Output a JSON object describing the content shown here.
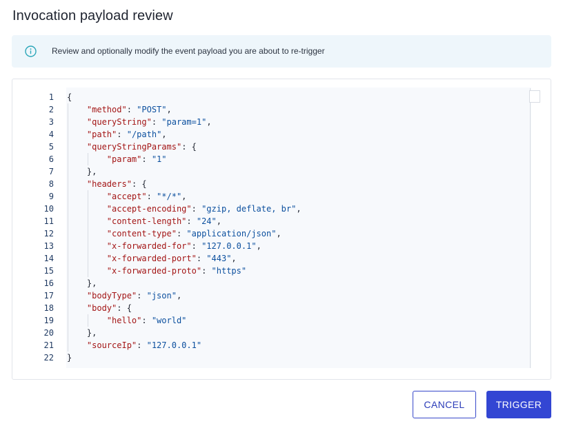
{
  "dialog": {
    "title": "Invocation payload review",
    "info_message": "Review and optionally modify the event payload you are about to re-trigger",
    "info_icon": "info-circle-icon"
  },
  "editor": {
    "line_numbers": [
      "1",
      "2",
      "3",
      "4",
      "5",
      "6",
      "7",
      "8",
      "9",
      "10",
      "11",
      "12",
      "13",
      "14",
      "15",
      "16",
      "17",
      "18",
      "19",
      "20",
      "21",
      "22"
    ],
    "lines": [
      {
        "indent": 0,
        "tokens": [
          {
            "t": "p",
            "v": "{"
          }
        ]
      },
      {
        "indent": 1,
        "tokens": [
          {
            "t": "k",
            "v": "\"method\""
          },
          {
            "t": "p",
            "v": ": "
          },
          {
            "t": "s",
            "v": "\"POST\""
          },
          {
            "t": "p",
            "v": ","
          }
        ]
      },
      {
        "indent": 1,
        "tokens": [
          {
            "t": "k",
            "v": "\"queryString\""
          },
          {
            "t": "p",
            "v": ": "
          },
          {
            "t": "s",
            "v": "\"param=1\""
          },
          {
            "t": "p",
            "v": ","
          }
        ]
      },
      {
        "indent": 1,
        "tokens": [
          {
            "t": "k",
            "v": "\"path\""
          },
          {
            "t": "p",
            "v": ": "
          },
          {
            "t": "s",
            "v": "\"/path\""
          },
          {
            "t": "p",
            "v": ","
          }
        ]
      },
      {
        "indent": 1,
        "tokens": [
          {
            "t": "k",
            "v": "\"queryStringParams\""
          },
          {
            "t": "p",
            "v": ": {"
          }
        ]
      },
      {
        "indent": 2,
        "tokens": [
          {
            "t": "k",
            "v": "\"param\""
          },
          {
            "t": "p",
            "v": ": "
          },
          {
            "t": "s",
            "v": "\"1\""
          }
        ]
      },
      {
        "indent": 1,
        "tokens": [
          {
            "t": "p",
            "v": "},"
          }
        ]
      },
      {
        "indent": 1,
        "tokens": [
          {
            "t": "k",
            "v": "\"headers\""
          },
          {
            "t": "p",
            "v": ": {"
          }
        ]
      },
      {
        "indent": 2,
        "tokens": [
          {
            "t": "k",
            "v": "\"accept\""
          },
          {
            "t": "p",
            "v": ": "
          },
          {
            "t": "s",
            "v": "\"*/*\""
          },
          {
            "t": "p",
            "v": ","
          }
        ]
      },
      {
        "indent": 2,
        "tokens": [
          {
            "t": "k",
            "v": "\"accept-encoding\""
          },
          {
            "t": "p",
            "v": ": "
          },
          {
            "t": "s",
            "v": "\"gzip, deflate, br\""
          },
          {
            "t": "p",
            "v": ","
          }
        ]
      },
      {
        "indent": 2,
        "tokens": [
          {
            "t": "k",
            "v": "\"content-length\""
          },
          {
            "t": "p",
            "v": ": "
          },
          {
            "t": "s",
            "v": "\"24\""
          },
          {
            "t": "p",
            "v": ","
          }
        ]
      },
      {
        "indent": 2,
        "tokens": [
          {
            "t": "k",
            "v": "\"content-type\""
          },
          {
            "t": "p",
            "v": ": "
          },
          {
            "t": "s",
            "v": "\"application/json\""
          },
          {
            "t": "p",
            "v": ","
          }
        ]
      },
      {
        "indent": 2,
        "tokens": [
          {
            "t": "k",
            "v": "\"x-forwarded-for\""
          },
          {
            "t": "p",
            "v": ": "
          },
          {
            "t": "s",
            "v": "\"127.0.0.1\""
          },
          {
            "t": "p",
            "v": ","
          }
        ]
      },
      {
        "indent": 2,
        "tokens": [
          {
            "t": "k",
            "v": "\"x-forwarded-port\""
          },
          {
            "t": "p",
            "v": ": "
          },
          {
            "t": "s",
            "v": "\"443\""
          },
          {
            "t": "p",
            "v": ","
          }
        ]
      },
      {
        "indent": 2,
        "tokens": [
          {
            "t": "k",
            "v": "\"x-forwarded-proto\""
          },
          {
            "t": "p",
            "v": ": "
          },
          {
            "t": "s",
            "v": "\"https\""
          }
        ]
      },
      {
        "indent": 1,
        "tokens": [
          {
            "t": "p",
            "v": "},"
          }
        ]
      },
      {
        "indent": 1,
        "tokens": [
          {
            "t": "k",
            "v": "\"bodyType\""
          },
          {
            "t": "p",
            "v": ": "
          },
          {
            "t": "s",
            "v": "\"json\""
          },
          {
            "t": "p",
            "v": ","
          }
        ]
      },
      {
        "indent": 1,
        "tokens": [
          {
            "t": "k",
            "v": "\"body\""
          },
          {
            "t": "p",
            "v": ": {"
          }
        ]
      },
      {
        "indent": 2,
        "tokens": [
          {
            "t": "k",
            "v": "\"hello\""
          },
          {
            "t": "p",
            "v": ": "
          },
          {
            "t": "s",
            "v": "\"world\""
          }
        ]
      },
      {
        "indent": 1,
        "tokens": [
          {
            "t": "p",
            "v": "},"
          }
        ]
      },
      {
        "indent": 1,
        "tokens": [
          {
            "t": "k",
            "v": "\"sourceIp\""
          },
          {
            "t": "p",
            "v": ": "
          },
          {
            "t": "s",
            "v": "\"127.0.0.1\""
          }
        ]
      },
      {
        "indent": 0,
        "tokens": [
          {
            "t": "p",
            "v": "}"
          }
        ]
      }
    ]
  },
  "actions": {
    "cancel_label": "CANCEL",
    "trigger_label": "TRIGGER"
  },
  "colors": {
    "accent": "#3346d3",
    "info_background": "#eef6fb",
    "json_key": "#a31515",
    "json_string": "#0b4f9e",
    "info_icon": "#2aa6b8"
  }
}
